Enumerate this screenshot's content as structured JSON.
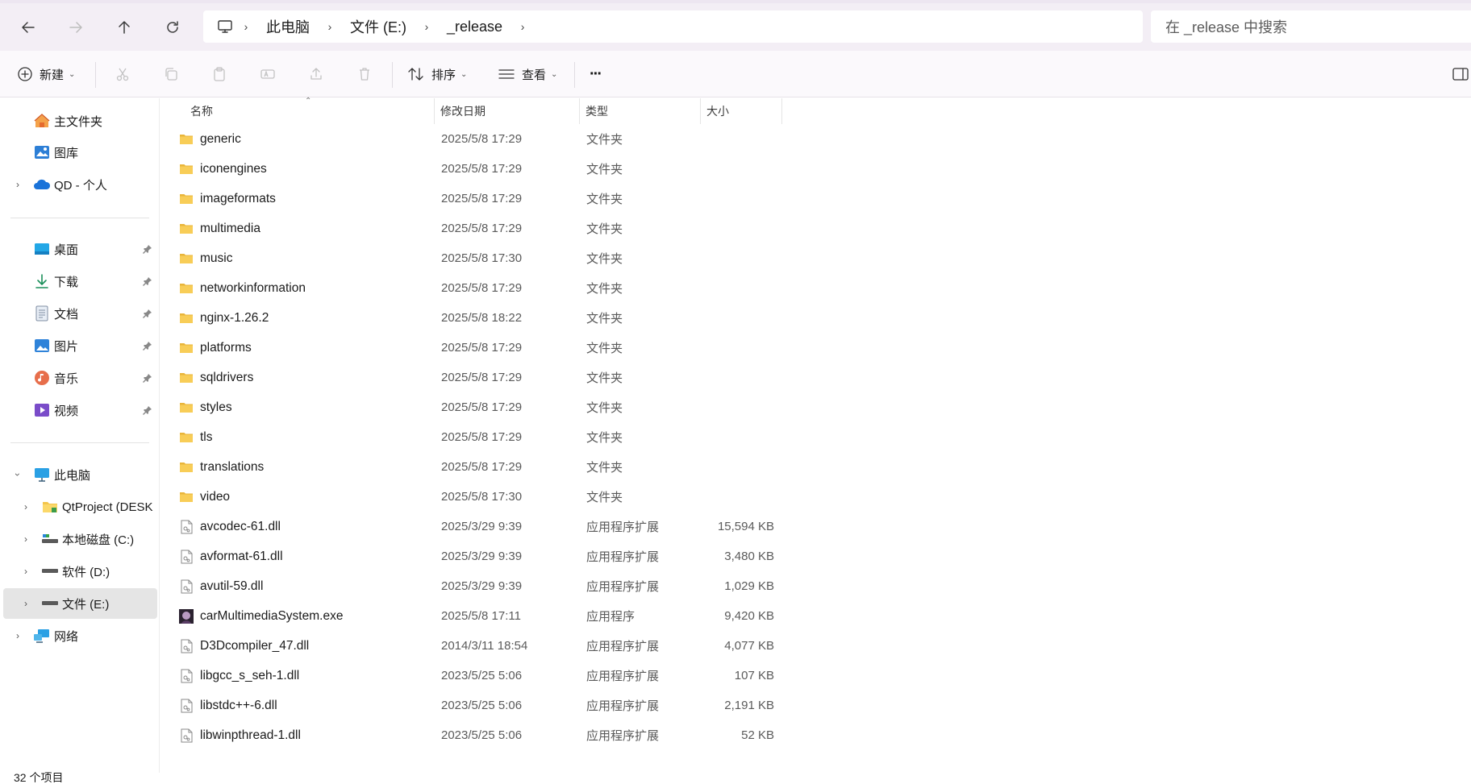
{
  "address": {
    "breadcrumbs": [
      "此电脑",
      "文件 (E:)",
      "_release"
    ],
    "search_placeholder": "在 _release 中搜索"
  },
  "toolbar": {
    "new_label": "新建",
    "sort_label": "排序",
    "view_label": "查看",
    "more_label": "···"
  },
  "sidebar": {
    "quick": [
      {
        "label": "主文件夹",
        "icon": "home-icon"
      },
      {
        "label": "图库",
        "icon": "gallery-icon"
      },
      {
        "label": "QD - 个人",
        "icon": "cloud-icon"
      }
    ],
    "pinned": [
      {
        "label": "桌面",
        "icon": "desktop-icon"
      },
      {
        "label": "下载",
        "icon": "download-icon"
      },
      {
        "label": "文档",
        "icon": "document-icon"
      },
      {
        "label": "图片",
        "icon": "pictures-icon"
      },
      {
        "label": "音乐",
        "icon": "music-icon"
      },
      {
        "label": "视频",
        "icon": "video-icon"
      }
    ],
    "tree": [
      {
        "label": "此电脑",
        "icon": "pc-icon"
      },
      {
        "label": "QtProject (DESK",
        "icon": "folder-icon"
      },
      {
        "label": "本地磁盘 (C:)",
        "icon": "drive-icon"
      },
      {
        "label": "软件 (D:)",
        "icon": "drive-icon"
      },
      {
        "label": "文件 (E:)",
        "icon": "drive-icon"
      },
      {
        "label": "网络",
        "icon": "network-icon"
      }
    ]
  },
  "columns": {
    "name": "名称",
    "date": "修改日期",
    "type": "类型",
    "size": "大小"
  },
  "files": [
    {
      "name": "generic",
      "date": "2025/5/8 17:29",
      "type": "文件夹",
      "size": "",
      "kind": "folder"
    },
    {
      "name": "iconengines",
      "date": "2025/5/8 17:29",
      "type": "文件夹",
      "size": "",
      "kind": "folder"
    },
    {
      "name": "imageformats",
      "date": "2025/5/8 17:29",
      "type": "文件夹",
      "size": "",
      "kind": "folder"
    },
    {
      "name": "multimedia",
      "date": "2025/5/8 17:29",
      "type": "文件夹",
      "size": "",
      "kind": "folder"
    },
    {
      "name": "music",
      "date": "2025/5/8 17:30",
      "type": "文件夹",
      "size": "",
      "kind": "folder"
    },
    {
      "name": "networkinformation",
      "date": "2025/5/8 17:29",
      "type": "文件夹",
      "size": "",
      "kind": "folder"
    },
    {
      "name": "nginx-1.26.2",
      "date": "2025/5/8 18:22",
      "type": "文件夹",
      "size": "",
      "kind": "folder"
    },
    {
      "name": "platforms",
      "date": "2025/5/8 17:29",
      "type": "文件夹",
      "size": "",
      "kind": "folder"
    },
    {
      "name": "sqldrivers",
      "date": "2025/5/8 17:29",
      "type": "文件夹",
      "size": "",
      "kind": "folder"
    },
    {
      "name": "styles",
      "date": "2025/5/8 17:29",
      "type": "文件夹",
      "size": "",
      "kind": "folder"
    },
    {
      "name": "tls",
      "date": "2025/5/8 17:29",
      "type": "文件夹",
      "size": "",
      "kind": "folder"
    },
    {
      "name": "translations",
      "date": "2025/5/8 17:29",
      "type": "文件夹",
      "size": "",
      "kind": "folder"
    },
    {
      "name": "video",
      "date": "2025/5/8 17:30",
      "type": "文件夹",
      "size": "",
      "kind": "folder"
    },
    {
      "name": "avcodec-61.dll",
      "date": "2025/3/29 9:39",
      "type": "应用程序扩展",
      "size": "15,594 KB",
      "kind": "dll"
    },
    {
      "name": "avformat-61.dll",
      "date": "2025/3/29 9:39",
      "type": "应用程序扩展",
      "size": "3,480 KB",
      "kind": "dll"
    },
    {
      "name": "avutil-59.dll",
      "date": "2025/3/29 9:39",
      "type": "应用程序扩展",
      "size": "1,029 KB",
      "kind": "dll"
    },
    {
      "name": "carMultimediaSystem.exe",
      "date": "2025/5/8 17:11",
      "type": "应用程序",
      "size": "9,420 KB",
      "kind": "exe"
    },
    {
      "name": "D3Dcompiler_47.dll",
      "date": "2014/3/11 18:54",
      "type": "应用程序扩展",
      "size": "4,077 KB",
      "kind": "dll"
    },
    {
      "name": "libgcc_s_seh-1.dll",
      "date": "2023/5/25 5:06",
      "type": "应用程序扩展",
      "size": "107 KB",
      "kind": "dll"
    },
    {
      "name": "libstdc++-6.dll",
      "date": "2023/5/25 5:06",
      "type": "应用程序扩展",
      "size": "2,191 KB",
      "kind": "dll"
    },
    {
      "name": "libwinpthread-1.dll",
      "date": "2023/5/25 5:06",
      "type": "应用程序扩展",
      "size": "52 KB",
      "kind": "dll"
    }
  ],
  "status": {
    "item_count": "32 个项目"
  }
}
